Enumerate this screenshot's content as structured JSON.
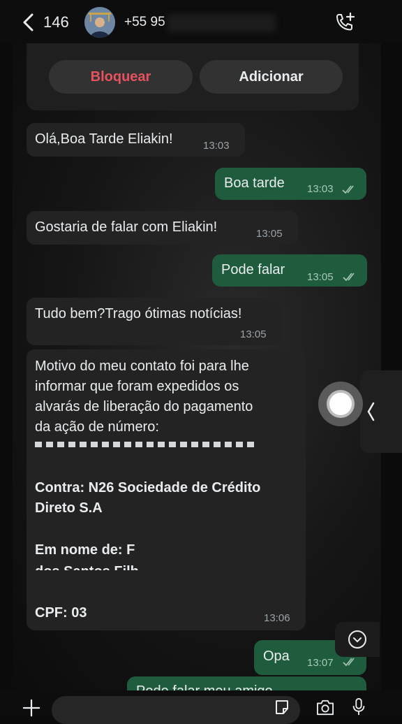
{
  "header": {
    "back_count": "146",
    "contact_name": "+55 95"
  },
  "contact_actions": {
    "block_label": "Bloquear",
    "add_label": "Adicionar"
  },
  "messages": [
    {
      "direction": "in",
      "text": "Olá,Boa Tarde Eliakin!",
      "time": "13:03"
    },
    {
      "direction": "out",
      "text": "Boa tarde",
      "time": "13:03",
      "status": "read"
    },
    {
      "direction": "in",
      "text": "Gostaria de falar com Eliakin!",
      "time": "13:05"
    },
    {
      "direction": "out",
      "text": "Pode falar",
      "time": "13:05",
      "status": "read"
    },
    {
      "direction": "in",
      "text": "Tudo bem?Trago ótimas notícias!",
      "time": "13:05"
    },
    {
      "direction": "in",
      "text": "Motivo do meu contato foi para lhe\ninformar que foram expedidos os\nalvarás de liberação do pagamento\nda ação de número:",
      "contra": "Contra: N26 Sociedade de Crédito\nDireto S.A",
      "em_nome": "Em nome de: F",
      "em_nome_cont": "dos Santos Filh",
      "cpf": "CPF: 03",
      "time": "13:06"
    },
    {
      "direction": "out",
      "text": "Opa",
      "time": "13:07",
      "status": "read"
    },
    {
      "direction": "out",
      "text": "Pode falar meu amigo",
      "time": ""
    }
  ],
  "colors": {
    "incoming_bubble": "#232323",
    "outgoing_bubble": "#1f5c3d",
    "block_red": "#e8525f"
  },
  "icons": [
    "back-chevron-icon",
    "avatar",
    "add-call-icon",
    "read-ticks-icon",
    "record-button",
    "chevron-left-icon",
    "scroll-down-icon",
    "plus-icon",
    "sticker-icon",
    "camera-icon",
    "mic-icon"
  ]
}
